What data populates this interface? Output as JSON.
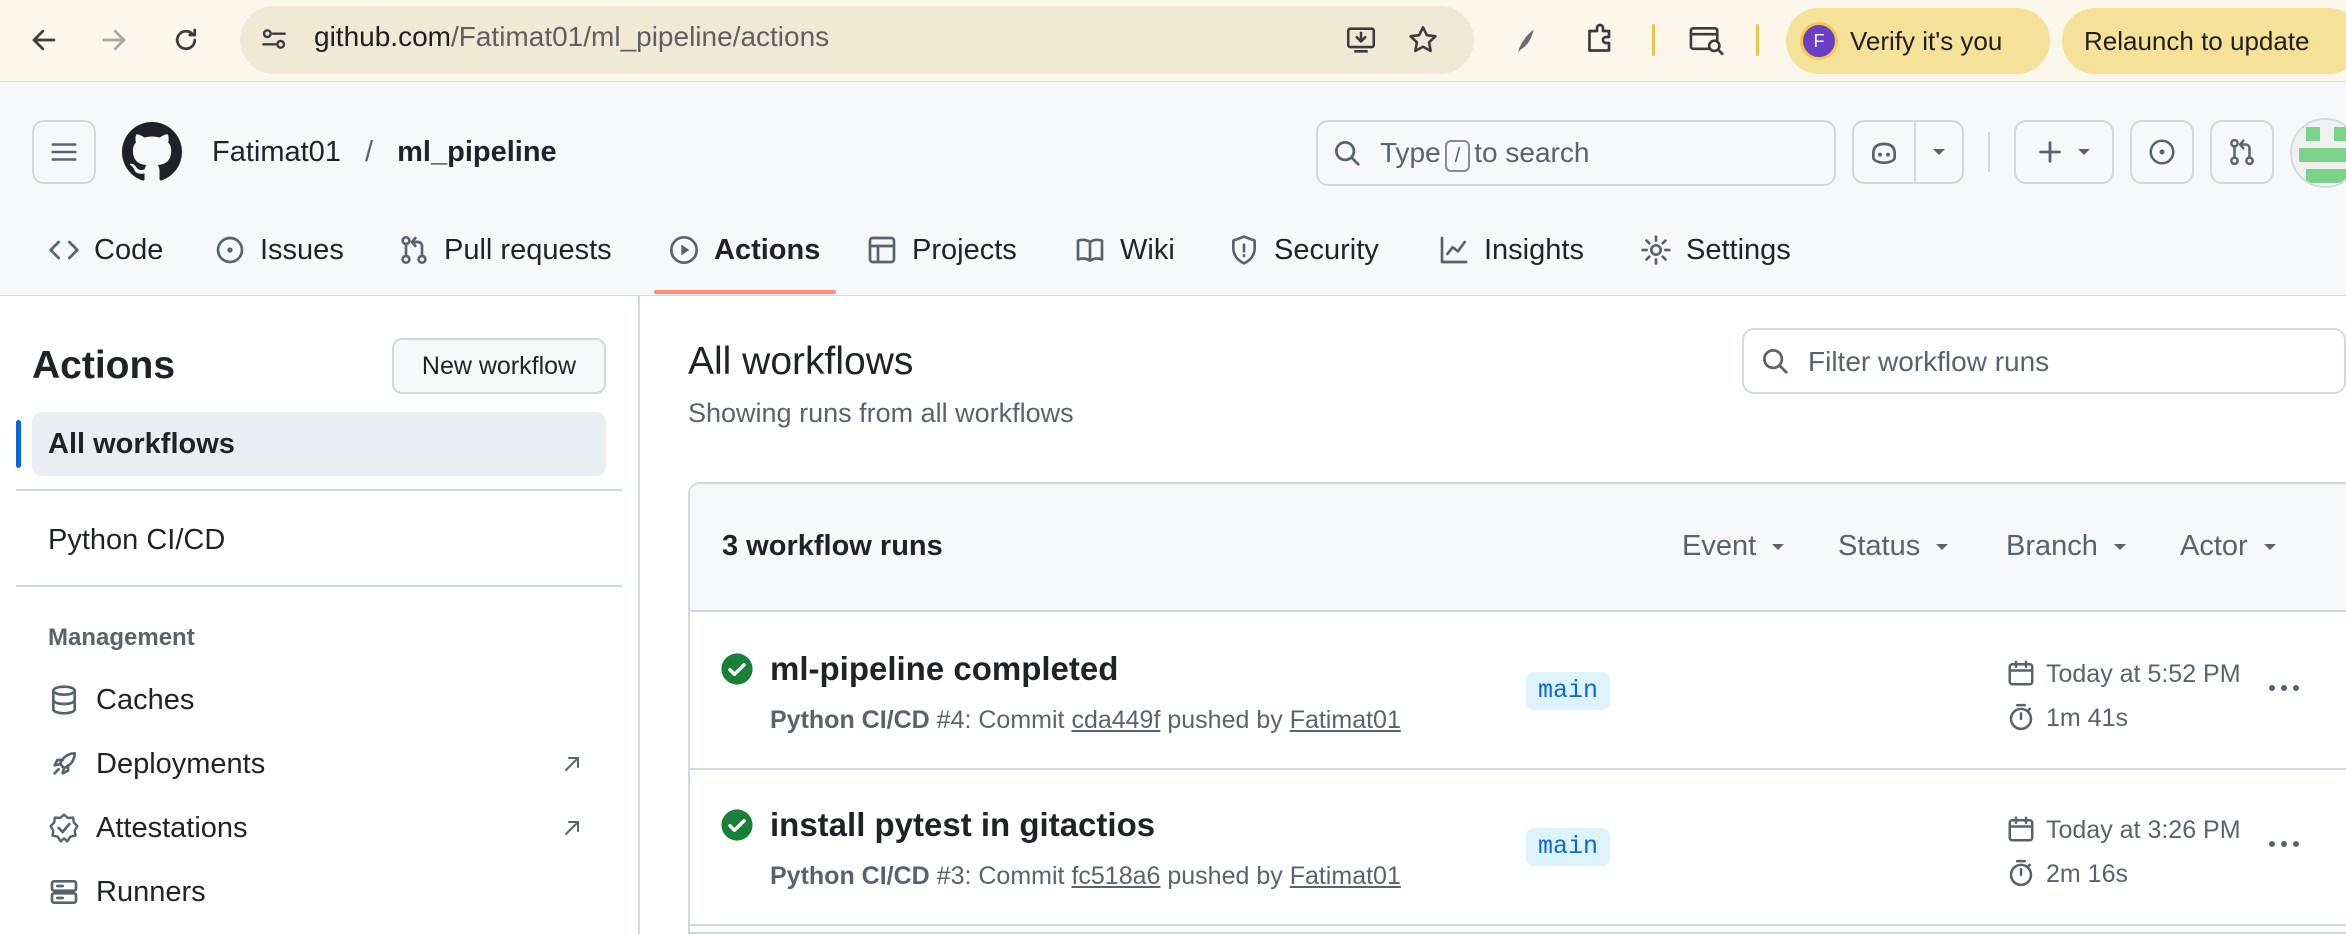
{
  "browser": {
    "url_host": "github.com",
    "url_path": "/Fatimat01/ml_pipeline/actions",
    "verify_label": "Verify it's you",
    "avatar_letter": "F",
    "relaunch_label": "Relaunch to update"
  },
  "header": {
    "owner": "Fatimat01",
    "separator": "/",
    "repo": "ml_pipeline",
    "search_prefix": "Type",
    "search_key": "/",
    "search_suffix": "to search"
  },
  "tabs": [
    {
      "label": "Code",
      "icon": "code-icon"
    },
    {
      "label": "Issues",
      "icon": "issue-icon"
    },
    {
      "label": "Pull requests",
      "icon": "pull-request-icon"
    },
    {
      "label": "Actions",
      "icon": "play-icon",
      "selected": true
    },
    {
      "label": "Projects",
      "icon": "table-icon"
    },
    {
      "label": "Wiki",
      "icon": "book-icon"
    },
    {
      "label": "Security",
      "icon": "shield-icon"
    },
    {
      "label": "Insights",
      "icon": "graph-icon"
    },
    {
      "label": "Settings",
      "icon": "gear-icon"
    }
  ],
  "sidebar": {
    "title": "Actions",
    "new_workflow": "New workflow",
    "all_workflows": "All workflows",
    "workflows": [
      "Python CI/CD"
    ],
    "management_heading": "Management",
    "management": [
      {
        "label": "Caches",
        "icon": "database-icon"
      },
      {
        "label": "Deployments",
        "icon": "rocket-icon",
        "external": true
      },
      {
        "label": "Attestations",
        "icon": "verified-icon",
        "external": true
      },
      {
        "label": "Runners",
        "icon": "server-icon"
      }
    ]
  },
  "main": {
    "title": "All workflows",
    "subtitle": "Showing runs from all workflows",
    "filter_placeholder": "Filter workflow runs",
    "runs_count": "3 workflow runs",
    "filters": [
      "Event",
      "Status",
      "Branch",
      "Actor"
    ],
    "runs": [
      {
        "title": "ml-pipeline completed",
        "workflow": "Python CI/CD",
        "number": "#4",
        "commit_prefix": ": Commit",
        "commit": "cda449f",
        "pushed_by": "pushed by",
        "actor": "Fatimat01",
        "branch": "main",
        "time": "Today at 5:52 PM",
        "duration": "1m 41s",
        "status": "success"
      },
      {
        "title": "install pytest in gitactios",
        "workflow": "Python CI/CD",
        "number": "#3",
        "commit_prefix": ": Commit",
        "commit": "fc518a6",
        "pushed_by": "pushed by",
        "actor": "Fatimat01",
        "branch": "main",
        "time": "Today at 3:26 PM",
        "duration": "2m 16s",
        "status": "success"
      }
    ]
  },
  "colors": {
    "accent_underline": "#fd8c73",
    "success": "#1a7f37",
    "link_blue": "#0969da",
    "selected_bar": "#0969da"
  }
}
